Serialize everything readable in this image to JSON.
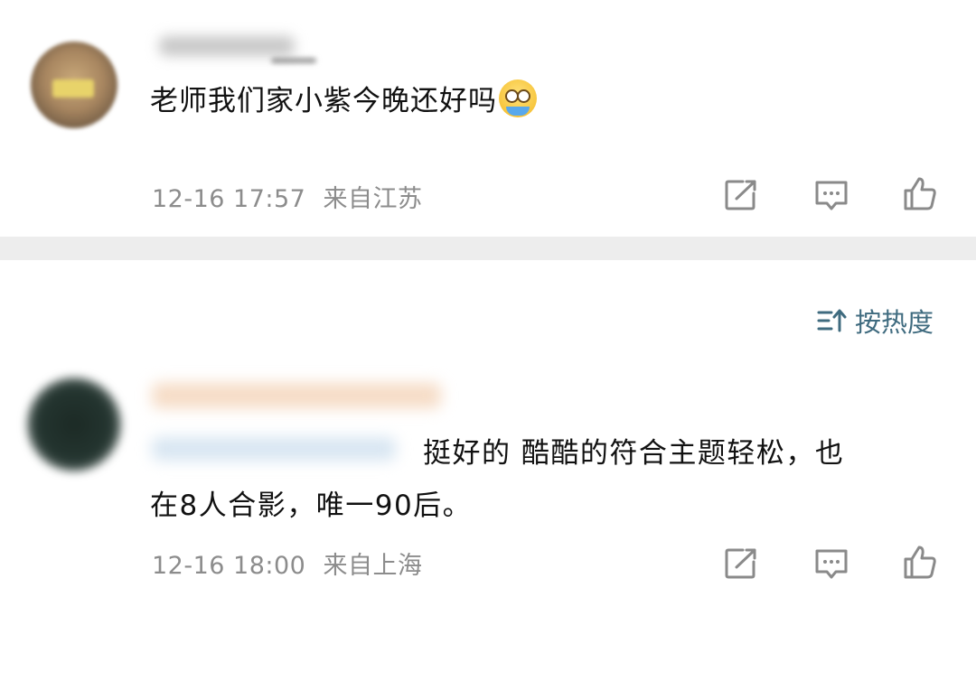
{
  "comments": [
    {
      "text": "老师我们家小紫今晚还好吗",
      "timestamp": "12-16 17:57",
      "location": "来自江苏",
      "emoji": "crying-face-emoji"
    },
    {
      "text_line1": "挺好的 酷酷的符合主题轻松，也",
      "text_line2": "在8人合影，唯一90后。",
      "timestamp": "12-16 18:00",
      "location": "来自上海"
    }
  ],
  "sort": {
    "label": "按热度",
    "icon": "sort-icon"
  },
  "actions": {
    "share_icon": "share-icon",
    "comment_icon": "comment-icon",
    "like_icon": "like-icon"
  },
  "colors": {
    "text": "#111111",
    "meta": "#8c8c8c",
    "icon": "#8a8a8a",
    "sort": "#3f6b7f",
    "separator": "#ededed"
  }
}
